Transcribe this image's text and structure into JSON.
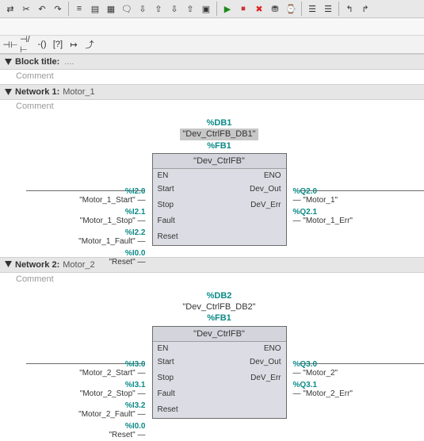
{
  "toolbar_top": {
    "icons": [
      "arrow-swap",
      "cut",
      "rotate-left",
      "rotate-right",
      "list",
      "form",
      "layout",
      "speech",
      "download",
      "upload",
      "download-db",
      "upload-db",
      "device",
      "play",
      "stop",
      "warning",
      "device-online",
      "device-time",
      "go-online",
      "go-offline",
      "go-left",
      "go-right"
    ]
  },
  "toolbar_fbd": {
    "icons": [
      "contact-no",
      "contact-nc",
      "coil",
      "box",
      "branch",
      "jump"
    ]
  },
  "block_title_bar": {
    "label": "Block title:",
    "comment_label": "Comment"
  },
  "networks": [
    {
      "header_label": "Network 1:",
      "name": "Motor_1",
      "comment": "Comment",
      "db_addr": "%DB1",
      "db_name": "\"Dev_CtrlFB_DB1\"",
      "fb_addr": "%FB1",
      "fb_name": "\"Dev_CtrlFB\"",
      "en_label": "EN",
      "eno_label": "ENO",
      "inputs": [
        {
          "addr": "%I2.0",
          "tag": "\"Motor_1_Start\"",
          "pin": "Start"
        },
        {
          "addr": "%I2.1",
          "tag": "\"Motor_1_Stop\"",
          "pin": "Stop"
        },
        {
          "addr": "%I2.2",
          "tag": "\"Motor_1_Fault\"",
          "pin": "Fault"
        },
        {
          "addr": "%I0.0",
          "tag": "\"Reset\"",
          "pin": "Reset"
        }
      ],
      "outputs": [
        {
          "addr": "%Q2.0",
          "tag": "\"Motor_1\"",
          "pin": "Dev_Out"
        },
        {
          "addr": "%Q2.1",
          "tag": "\"Motor_1_Err\"",
          "pin": "DeV_Err"
        }
      ]
    },
    {
      "header_label": "Network 2:",
      "name": "Motor_2",
      "comment": "Comment",
      "db_addr": "%DB2",
      "db_name": "\"Dev_CtrlFB_DB2\"",
      "fb_addr": "%FB1",
      "fb_name": "\"Dev_CtrlFB\"",
      "en_label": "EN",
      "eno_label": "ENO",
      "inputs": [
        {
          "addr": "%I3.0",
          "tag": "\"Motor_2_Start\"",
          "pin": "Start"
        },
        {
          "addr": "%I3.1",
          "tag": "\"Motor_2_Stop\"",
          "pin": "Stop"
        },
        {
          "addr": "%I3.2",
          "tag": "\"Motor_2_Fault\"",
          "pin": "Fault"
        },
        {
          "addr": "%I0.0",
          "tag": "\"Reset\"",
          "pin": "Reset"
        }
      ],
      "outputs": [
        {
          "addr": "%Q3.0",
          "tag": "\"Motor_2\"",
          "pin": "Dev_Out"
        },
        {
          "addr": "%Q3.1",
          "tag": "\"Motor_2_Err\"",
          "pin": "DeV_Err"
        }
      ]
    }
  ]
}
